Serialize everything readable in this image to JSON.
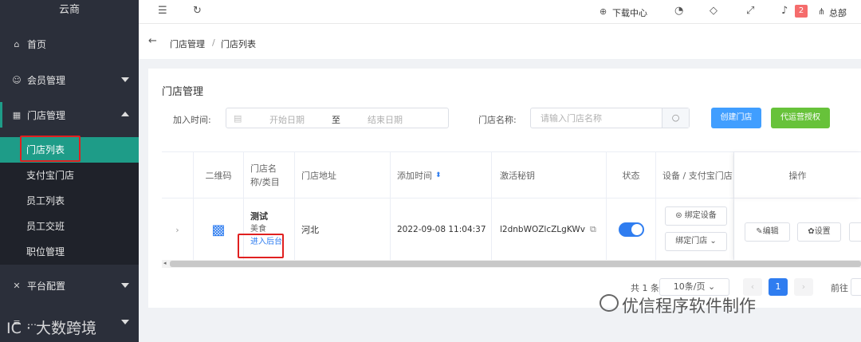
{
  "sidebar": {
    "brand": "云商",
    "items": [
      {
        "label": "首页",
        "icon": "home-icon",
        "glyph": "⌂"
      },
      {
        "label": "会员管理",
        "icon": "user-icon",
        "glyph": "☺"
      },
      {
        "label": "门店管理",
        "icon": "store-icon",
        "glyph": "▦"
      },
      {
        "label": "平台配置",
        "icon": "tools-icon",
        "glyph": "✕"
      },
      {
        "label": "…",
        "icon": "menu-icon",
        "glyph": "≡"
      }
    ],
    "sub_items": [
      {
        "label": "门店列表",
        "active": true
      },
      {
        "label": "支付宝门店"
      },
      {
        "label": "员工列表"
      },
      {
        "label": "员工交班"
      },
      {
        "label": "职位管理"
      }
    ]
  },
  "topbar": {
    "download": "下载中心",
    "notify_count": "2",
    "user": "总部"
  },
  "breadcrumb": {
    "parent": "门店管理",
    "sep": "/",
    "current": "门店列表"
  },
  "card": {
    "title": "门店管理",
    "filter_time_label": "加入时间:",
    "start_date_placeholder": "开始日期",
    "range_sep": "至",
    "end_date_placeholder": "结束日期",
    "store_name_label": "门店名称:",
    "store_name_placeholder": "请输入门店名称",
    "create_button": "创建门店",
    "auth_button": "代运营授权"
  },
  "table": {
    "headers": {
      "qrcode": "二维码",
      "name_line1": "门店名",
      "name_line2": "称/类目",
      "address": "门店地址",
      "added": "添加时间",
      "secret": "激活秘钥",
      "status": "状态",
      "device": "设备 / 支付宝门店",
      "ops": "操作"
    },
    "row": {
      "name": "测试",
      "category": "美食",
      "admin_link": "进入后台",
      "address": "河北",
      "added": "2022-09-08 11:04:37",
      "secret": "l2dnbWOZlcZLgKWv",
      "status_on": true,
      "bind_device": "绑定设备",
      "bind_store": "绑定门店",
      "edit": "编辑",
      "settings": "设置"
    }
  },
  "pagination": {
    "total": "共 1 条",
    "page_size": "10条/页",
    "current_page": "1",
    "goto": "前往"
  },
  "watermark": {
    "text": "优信程序软件制作"
  },
  "colors": {
    "sidebar_bg": "#2b2f3a",
    "accent": "#1e9c88",
    "primary": "#2f7df0",
    "create_btn": "#409eff",
    "auth_btn": "#67c23a",
    "highlight_box": "#e02020"
  }
}
